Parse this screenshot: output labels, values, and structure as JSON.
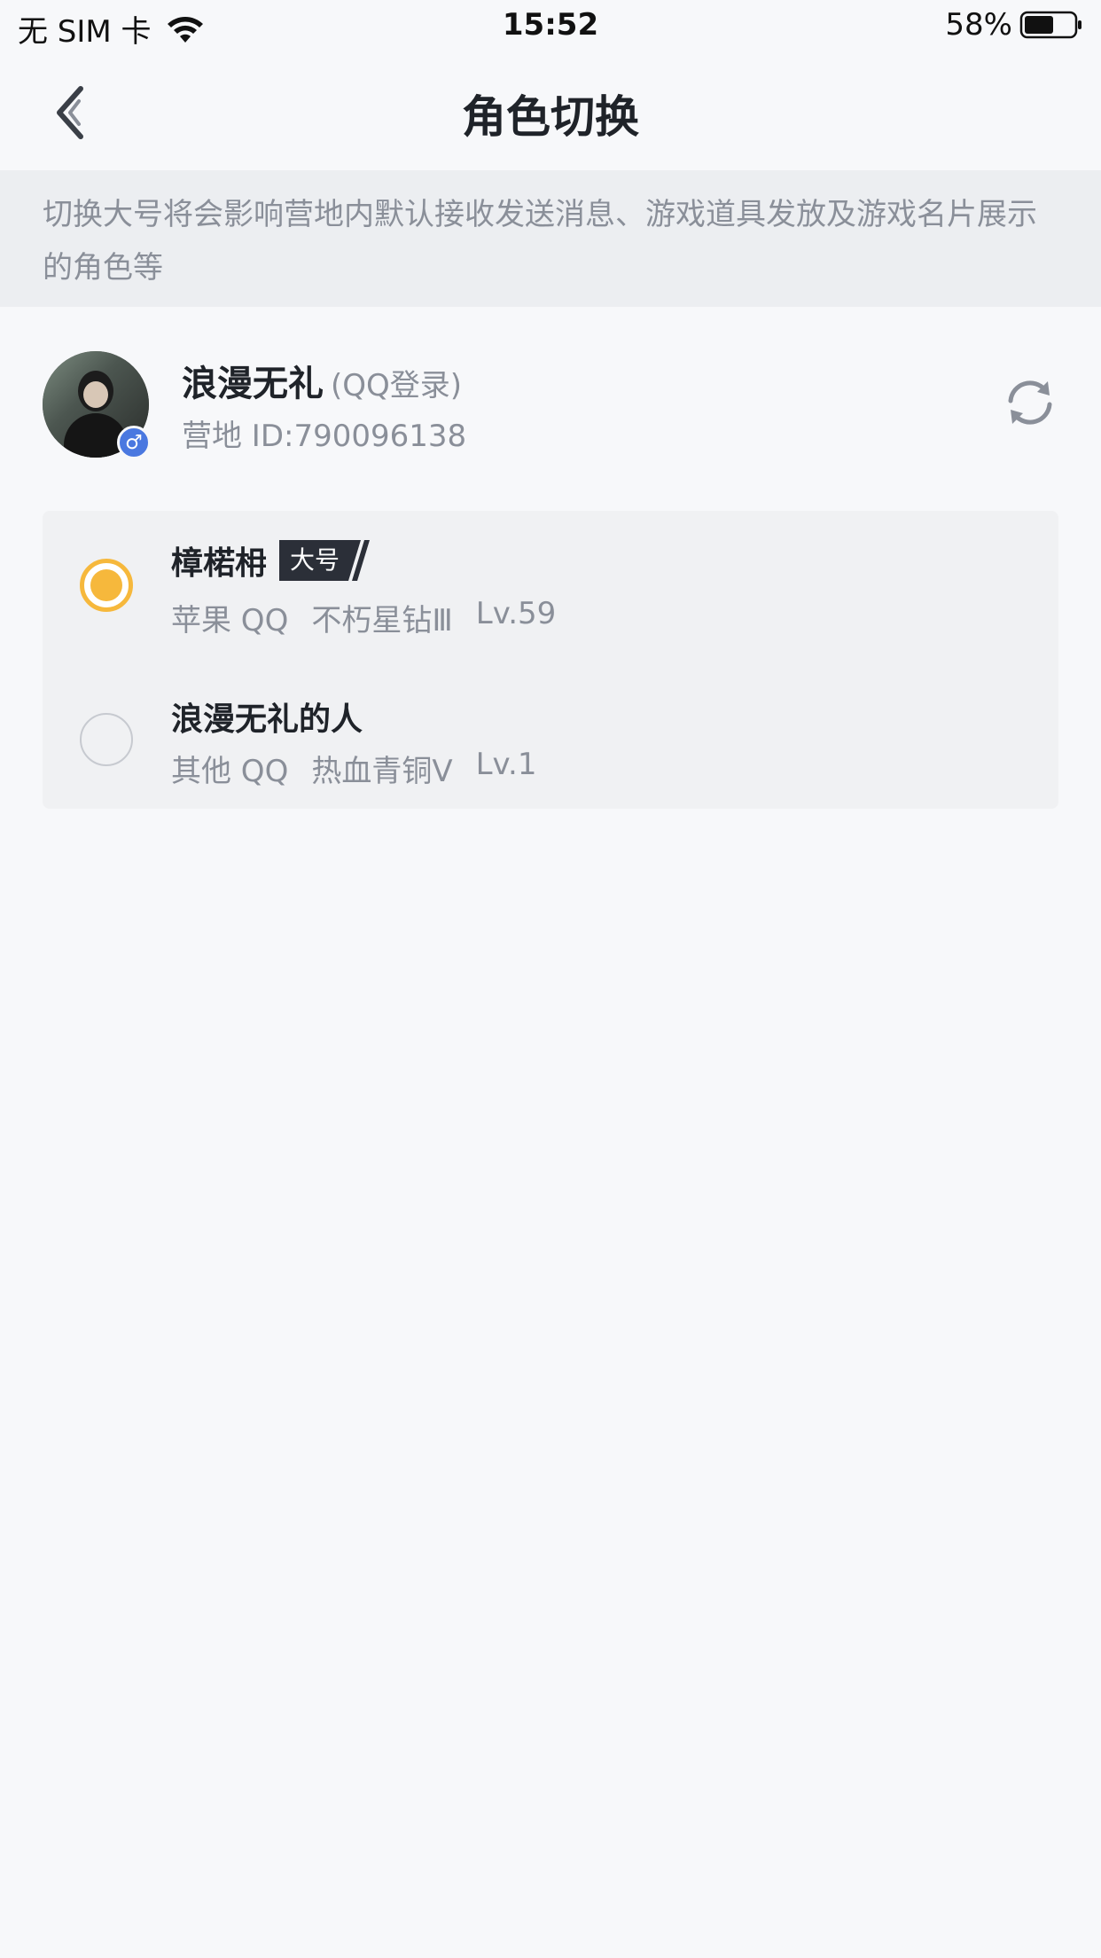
{
  "status_bar": {
    "carrier": "无 SIM 卡",
    "time": "15:52",
    "battery": "58%"
  },
  "nav": {
    "title": "角色切换"
  },
  "notice": {
    "text": "切换大号将会影响营地内默认接收发送消息、游戏道具发放及游戏名片展示的角色等"
  },
  "account": {
    "name": "浪漫无礼",
    "login_type": "(QQ登录)",
    "camp_id": "营地 ID:790096138",
    "gender_symbol": "♂"
  },
  "roles": [
    {
      "name": "樟楉枏",
      "badge": "大号",
      "platform": "苹果 QQ",
      "rank": "不朽星钻Ⅲ",
      "level": "Lv.59",
      "selected": true
    },
    {
      "name": "浪漫无礼的人",
      "platform": "其他 QQ",
      "rank": "热血青铜Ⅴ",
      "level": "Lv.1",
      "selected": false
    }
  ],
  "colors": {
    "accent": "#f6b83c",
    "background": "#f7f8fa",
    "notice_bg": "#eceef1",
    "muted_text": "#8a8f99",
    "badge_bg": "#2b2f38",
    "gender_badge": "#4a78e0"
  },
  "icons": {
    "back": "chevron-left-icon",
    "refresh": "refresh-icon",
    "wifi": "wifi-icon",
    "battery": "battery-icon"
  }
}
